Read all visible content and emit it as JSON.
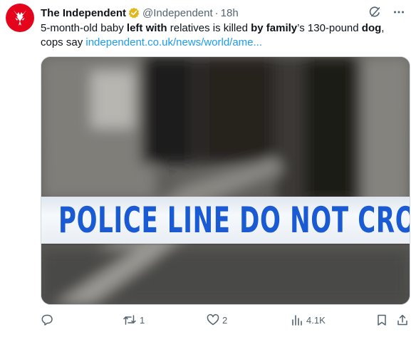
{
  "tweet": {
    "author_name": "The Independent",
    "handle": "@Independent",
    "separator": "·",
    "time": "18h",
    "text_part1": "5-month-old baby ",
    "text_bold1": "left with",
    "text_part2": " relatives is killed ",
    "text_bold2": "by family",
    "text_part3": "’s 130-pound ",
    "text_bold3": "dog",
    "text_part4": ",",
    "text_part5": "cops say ",
    "link": "independent.co.uk/news/world/ame..."
  },
  "media": {
    "tape_text": "POLICE LINE DO NOT CROSS",
    "tape_color": "#1a5bd3"
  },
  "actions": {
    "reply_count": "",
    "retweet_count": "1",
    "like_count": "2",
    "views_count": "4.1K"
  },
  "icons": [
    "independent-eagle-logo",
    "verified-badge-icon",
    "grok-icon",
    "more-icon",
    "reply-icon",
    "retweet-icon",
    "like-icon",
    "views-icon",
    "bookmark-icon",
    "share-icon"
  ],
  "colors": {
    "accent": "#1d9bf0",
    "muted": "#536471",
    "brand": "#e4051c",
    "verified": "#e2b719"
  }
}
